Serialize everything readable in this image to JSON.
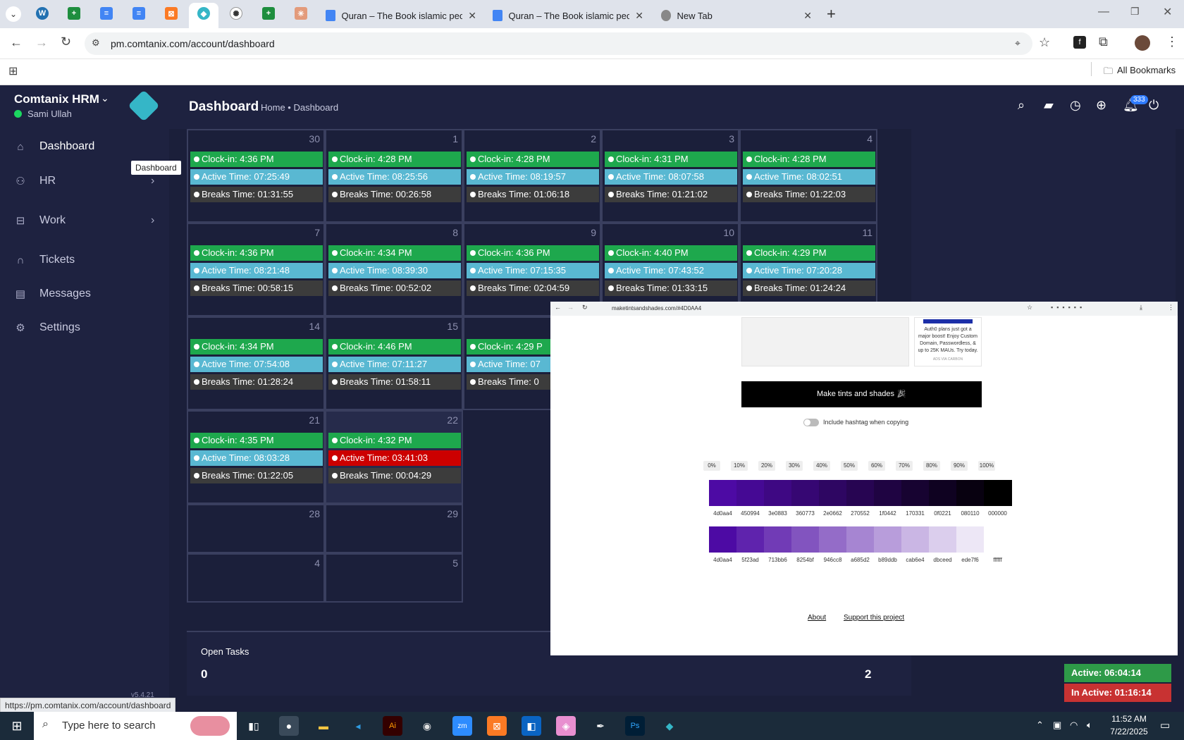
{
  "browser": {
    "tabs": [
      {
        "title": "Quran – The Book islamic peopl"
      },
      {
        "title": "Quran – The Book islamic peopl"
      },
      {
        "title": "New Tab"
      }
    ],
    "url": "pm.comtanix.com/account/dashboard",
    "bookmarks_label": "All Bookmarks",
    "status_url": "https://pm.comtanix.com/account/dashboard"
  },
  "app": {
    "brand": "Comtanix HRM",
    "user": "Sami Ullah",
    "page_title": "Dashboard",
    "breadcrumb": "Home • Dashboard",
    "notif_count": "333",
    "tooltip": "Dashboard",
    "version": "v5.4.21"
  },
  "sidebar": {
    "items": [
      {
        "label": "Dashboard",
        "icon": "home-icon"
      },
      {
        "label": "HR",
        "icon": "users-icon"
      },
      {
        "label": "Work",
        "icon": "briefcase-icon"
      },
      {
        "label": "Tickets",
        "icon": "headset-icon"
      },
      {
        "label": "Messages",
        "icon": "message-icon"
      },
      {
        "label": "Settings",
        "icon": "gear-icon"
      }
    ]
  },
  "calendar": {
    "weeks": [
      {
        "days": [
          {
            "d": "30",
            "ci": "Clock-in: 4:36 PM",
            "at": "Active Time: 07:25:49",
            "bt": "Breaks Time: 01:31:55"
          },
          {
            "d": "1",
            "ci": "Clock-in: 4:28 PM",
            "at": "Active Time: 08:25:56",
            "bt": "Breaks Time: 00:26:58"
          },
          {
            "d": "2",
            "ci": "Clock-in: 4:28 PM",
            "at": "Active Time: 08:19:57",
            "bt": "Breaks Time: 01:06:18"
          },
          {
            "d": "3",
            "ci": "Clock-in: 4:31 PM",
            "at": "Active Time: 08:07:58",
            "bt": "Breaks Time: 01:21:02"
          },
          {
            "d": "4",
            "ci": "Clock-in: 4:28 PM",
            "at": "Active Time: 08:02:51",
            "bt": "Breaks Time: 01:22:03"
          }
        ]
      },
      {
        "days": [
          {
            "d": "7",
            "ci": "Clock-in: 4:36 PM",
            "at": "Active Time: 08:21:48",
            "bt": "Breaks Time: 00:58:15"
          },
          {
            "d": "8",
            "ci": "Clock-in: 4:34 PM",
            "at": "Active Time: 08:39:30",
            "bt": "Breaks Time: 00:52:02"
          },
          {
            "d": "9",
            "ci": "Clock-in: 4:36 PM",
            "at": "Active Time: 07:15:35",
            "bt": "Breaks Time: 02:04:59"
          },
          {
            "d": "10",
            "ci": "Clock-in: 4:40 PM",
            "at": "Active Time: 07:43:52",
            "bt": "Breaks Time: 01:33:15"
          },
          {
            "d": "11",
            "ci": "Clock-in: 4:29 PM",
            "at": "Active Time: 07:20:28",
            "bt": "Breaks Time: 01:24:24"
          }
        ]
      },
      {
        "days": [
          {
            "d": "14",
            "ci": "Clock-in: 4:34 PM",
            "at": "Active Time: 07:54:08",
            "bt": "Breaks Time: 01:28:24"
          },
          {
            "d": "15",
            "ci": "Clock-in: 4:46 PM",
            "at": "Active Time: 07:11:27",
            "bt": "Breaks Time: 01:58:11"
          },
          {
            "d": "",
            "ci": "Clock-in: 4:29 P",
            "at": "Active Time: 07",
            "bt": "Breaks Time: 0"
          }
        ]
      },
      {
        "days": [
          {
            "d": "21",
            "ci": "Clock-in: 4:35 PM",
            "at": "Active Time: 08:03:28",
            "bt": "Breaks Time: 01:22:05"
          },
          {
            "d": "22",
            "ci": "Clock-in: 4:32 PM",
            "at": "Active Time: 03:41:03",
            "bt": "Breaks Time: 00:04:29"
          }
        ]
      },
      {
        "days": [
          {
            "d": "28"
          },
          {
            "d": "29"
          }
        ]
      },
      {
        "days": [
          {
            "d": "4"
          },
          {
            "d": "5"
          }
        ]
      }
    ]
  },
  "tasks": {
    "label": "Open Tasks",
    "count_left": "0",
    "count_right": "2"
  },
  "timer": {
    "active": "Active: 06:04:14",
    "inactive": "In Active: 01:16:14"
  },
  "popup": {
    "url": "maketintsandshades.com/#4D0AA4",
    "ad_text": "Auth0 plans just got a major boost! Enjoy Custom Domain, Passwordless, & up to 25K MAUs. Try today.",
    "ad_via": "ADS VIA CARBON",
    "button": "Make tints and shades",
    "toggle_label": "Include hashtag when copying",
    "percents": [
      "0%",
      "10%",
      "20%",
      "30%",
      "40%",
      "50%",
      "60%",
      "70%",
      "80%",
      "90%",
      "100%"
    ],
    "shades": [
      "4d0aa4",
      "450994",
      "3e0883",
      "360773",
      "2e0662",
      "270552",
      "1f0442",
      "170331",
      "0f0221",
      "080110",
      "000000"
    ],
    "tints": [
      "4d0aa4",
      "5f23ad",
      "713bb6",
      "8254bf",
      "946cc8",
      "a685d2",
      "b89ddb",
      "cab6e4",
      "dbceed",
      "ede7f6",
      "ffffff"
    ],
    "links": [
      "About",
      "Support this project"
    ]
  },
  "taskbar": {
    "search": "Type here to search",
    "time": "11:52 AM",
    "date": "7/22/2025"
  }
}
